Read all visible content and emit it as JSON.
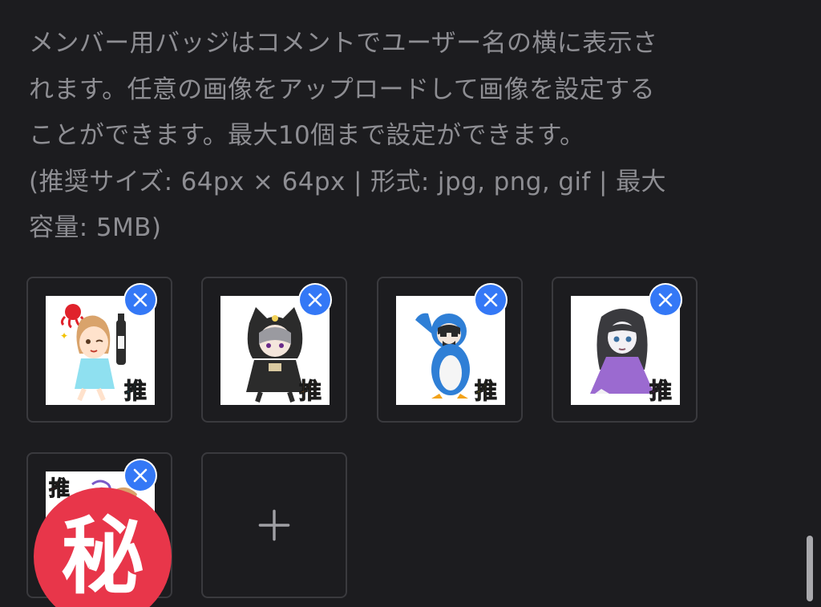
{
  "description": {
    "lines": [
      "メンバー用バッジはコメントでユーザー名の横に表示さ",
      "れます。任意の画像をアップロードして画像を設定する",
      "ことができます。最大10個まで設定ができます。",
      "(推奨サイズ: 64px × 64px | 形式: jpg, png, gif | 最大",
      "容量: 5MB)"
    ]
  },
  "badges": [
    {
      "label": "推",
      "label_color": "#2cb7d6",
      "character": "girl-with-bottle"
    },
    {
      "label": "推",
      "label_color": "#f08a1c",
      "character": "cat-hood-girl"
    },
    {
      "label": "推",
      "label_color": "#f2e21a",
      "character": "penguin-costume"
    },
    {
      "label": "推",
      "label_color": "#e24bd8",
      "character": "long-hair-girl"
    },
    {
      "label": "推",
      "label_color": "#e0222b",
      "character": "hidden-character"
    }
  ],
  "overlay_sticker": {
    "text": "秘",
    "color": "#e8364a"
  },
  "add_button": {
    "symbol": "+"
  },
  "colors": {
    "background": "#1c1c1f",
    "text": "#8e8e93",
    "tile_border": "#3a3a3e",
    "remove_button": "#3478f6"
  },
  "icons": {
    "remove": "close-icon",
    "add": "plus-icon"
  }
}
